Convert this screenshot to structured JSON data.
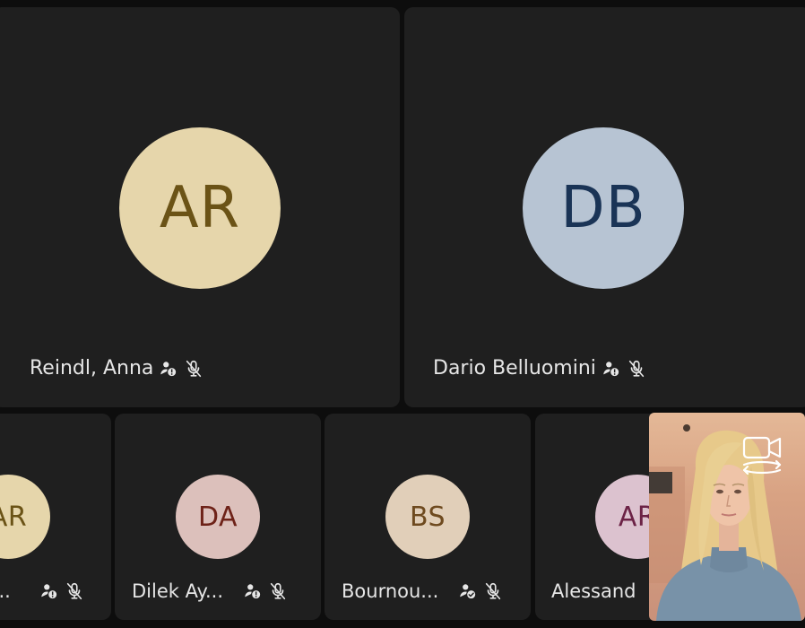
{
  "participants_main": [
    {
      "initials": "AR",
      "name": "Reindl, Anna",
      "avatar_bg": "#e6d6ab",
      "avatar_fg": "#6b5316"
    },
    {
      "initials": "DB",
      "name": "Dario Belluomini",
      "avatar_bg": "#b7c4d3",
      "avatar_fg": "#1a3456"
    }
  ],
  "participants_strip": [
    {
      "initials": "AR",
      "name": "j...",
      "avatar_bg": "#e6d6ab",
      "avatar_fg": "#6b5316",
      "status": "info"
    },
    {
      "initials": "DA",
      "name": "Dilek Ay...",
      "avatar_bg": "#dcc0bb",
      "avatar_fg": "#6e2218",
      "status": "info"
    },
    {
      "initials": "BS",
      "name": "Bournou...",
      "avatar_bg": "#e1cfb9",
      "avatar_fg": "#6e4a1f",
      "status": "check"
    },
    {
      "initials": "AR",
      "name": "Alessand",
      "avatar_bg": "#dcc2cf",
      "avatar_fg": "#6c2246",
      "status": "none"
    }
  ],
  "icons": {
    "info_status": "info-badge-icon",
    "check_status": "check-badge-icon",
    "mic_muted": "mic-off-icon",
    "camera_switch": "camera-switch-icon"
  },
  "colors": {
    "background": "#0d0d0d",
    "tile": "#1f1f1f",
    "text": "#e6e6e6"
  }
}
